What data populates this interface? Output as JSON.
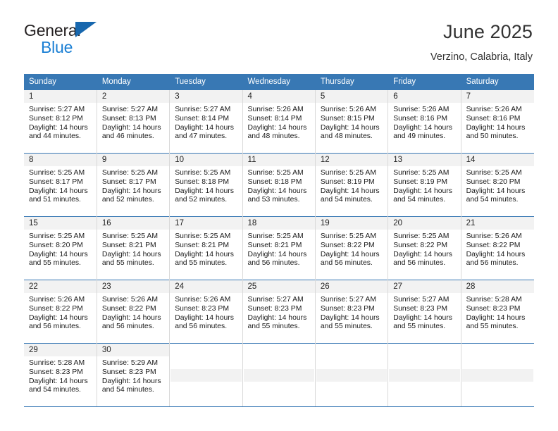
{
  "brand": {
    "name_part1": "General",
    "name_part2": "Blue",
    "triangle_color": "#1767ae",
    "blue_color": "#1a7fd4"
  },
  "header": {
    "title": "June 2025",
    "subtitle": "Verzino, Calabria, Italy"
  },
  "calendar": {
    "header_bg": "#3878b4",
    "daynum_bg": "#f2f2f2",
    "weekdays": [
      "Sunday",
      "Monday",
      "Tuesday",
      "Wednesday",
      "Thursday",
      "Friday",
      "Saturday"
    ],
    "weeks": [
      [
        {
          "day": "1",
          "sunrise": "Sunrise: 5:27 AM",
          "sunset": "Sunset: 8:12 PM",
          "daylight_line1": "Daylight: 14 hours",
          "daylight_line2": "and 44 minutes."
        },
        {
          "day": "2",
          "sunrise": "Sunrise: 5:27 AM",
          "sunset": "Sunset: 8:13 PM",
          "daylight_line1": "Daylight: 14 hours",
          "daylight_line2": "and 46 minutes."
        },
        {
          "day": "3",
          "sunrise": "Sunrise: 5:27 AM",
          "sunset": "Sunset: 8:14 PM",
          "daylight_line1": "Daylight: 14 hours",
          "daylight_line2": "and 47 minutes."
        },
        {
          "day": "4",
          "sunrise": "Sunrise: 5:26 AM",
          "sunset": "Sunset: 8:14 PM",
          "daylight_line1": "Daylight: 14 hours",
          "daylight_line2": "and 48 minutes."
        },
        {
          "day": "5",
          "sunrise": "Sunrise: 5:26 AM",
          "sunset": "Sunset: 8:15 PM",
          "daylight_line1": "Daylight: 14 hours",
          "daylight_line2": "and 48 minutes."
        },
        {
          "day": "6",
          "sunrise": "Sunrise: 5:26 AM",
          "sunset": "Sunset: 8:16 PM",
          "daylight_line1": "Daylight: 14 hours",
          "daylight_line2": "and 49 minutes."
        },
        {
          "day": "7",
          "sunrise": "Sunrise: 5:26 AM",
          "sunset": "Sunset: 8:16 PM",
          "daylight_line1": "Daylight: 14 hours",
          "daylight_line2": "and 50 minutes."
        }
      ],
      [
        {
          "day": "8",
          "sunrise": "Sunrise: 5:25 AM",
          "sunset": "Sunset: 8:17 PM",
          "daylight_line1": "Daylight: 14 hours",
          "daylight_line2": "and 51 minutes."
        },
        {
          "day": "9",
          "sunrise": "Sunrise: 5:25 AM",
          "sunset": "Sunset: 8:17 PM",
          "daylight_line1": "Daylight: 14 hours",
          "daylight_line2": "and 52 minutes."
        },
        {
          "day": "10",
          "sunrise": "Sunrise: 5:25 AM",
          "sunset": "Sunset: 8:18 PM",
          "daylight_line1": "Daylight: 14 hours",
          "daylight_line2": "and 52 minutes."
        },
        {
          "day": "11",
          "sunrise": "Sunrise: 5:25 AM",
          "sunset": "Sunset: 8:18 PM",
          "daylight_line1": "Daylight: 14 hours",
          "daylight_line2": "and 53 minutes."
        },
        {
          "day": "12",
          "sunrise": "Sunrise: 5:25 AM",
          "sunset": "Sunset: 8:19 PM",
          "daylight_line1": "Daylight: 14 hours",
          "daylight_line2": "and 54 minutes."
        },
        {
          "day": "13",
          "sunrise": "Sunrise: 5:25 AM",
          "sunset": "Sunset: 8:19 PM",
          "daylight_line1": "Daylight: 14 hours",
          "daylight_line2": "and 54 minutes."
        },
        {
          "day": "14",
          "sunrise": "Sunrise: 5:25 AM",
          "sunset": "Sunset: 8:20 PM",
          "daylight_line1": "Daylight: 14 hours",
          "daylight_line2": "and 54 minutes."
        }
      ],
      [
        {
          "day": "15",
          "sunrise": "Sunrise: 5:25 AM",
          "sunset": "Sunset: 8:20 PM",
          "daylight_line1": "Daylight: 14 hours",
          "daylight_line2": "and 55 minutes."
        },
        {
          "day": "16",
          "sunrise": "Sunrise: 5:25 AM",
          "sunset": "Sunset: 8:21 PM",
          "daylight_line1": "Daylight: 14 hours",
          "daylight_line2": "and 55 minutes."
        },
        {
          "day": "17",
          "sunrise": "Sunrise: 5:25 AM",
          "sunset": "Sunset: 8:21 PM",
          "daylight_line1": "Daylight: 14 hours",
          "daylight_line2": "and 55 minutes."
        },
        {
          "day": "18",
          "sunrise": "Sunrise: 5:25 AM",
          "sunset": "Sunset: 8:21 PM",
          "daylight_line1": "Daylight: 14 hours",
          "daylight_line2": "and 56 minutes."
        },
        {
          "day": "19",
          "sunrise": "Sunrise: 5:25 AM",
          "sunset": "Sunset: 8:22 PM",
          "daylight_line1": "Daylight: 14 hours",
          "daylight_line2": "and 56 minutes."
        },
        {
          "day": "20",
          "sunrise": "Sunrise: 5:25 AM",
          "sunset": "Sunset: 8:22 PM",
          "daylight_line1": "Daylight: 14 hours",
          "daylight_line2": "and 56 minutes."
        },
        {
          "day": "21",
          "sunrise": "Sunrise: 5:26 AM",
          "sunset": "Sunset: 8:22 PM",
          "daylight_line1": "Daylight: 14 hours",
          "daylight_line2": "and 56 minutes."
        }
      ],
      [
        {
          "day": "22",
          "sunrise": "Sunrise: 5:26 AM",
          "sunset": "Sunset: 8:22 PM",
          "daylight_line1": "Daylight: 14 hours",
          "daylight_line2": "and 56 minutes."
        },
        {
          "day": "23",
          "sunrise": "Sunrise: 5:26 AM",
          "sunset": "Sunset: 8:22 PM",
          "daylight_line1": "Daylight: 14 hours",
          "daylight_line2": "and 56 minutes."
        },
        {
          "day": "24",
          "sunrise": "Sunrise: 5:26 AM",
          "sunset": "Sunset: 8:23 PM",
          "daylight_line1": "Daylight: 14 hours",
          "daylight_line2": "and 56 minutes."
        },
        {
          "day": "25",
          "sunrise": "Sunrise: 5:27 AM",
          "sunset": "Sunset: 8:23 PM",
          "daylight_line1": "Daylight: 14 hours",
          "daylight_line2": "and 55 minutes."
        },
        {
          "day": "26",
          "sunrise": "Sunrise: 5:27 AM",
          "sunset": "Sunset: 8:23 PM",
          "daylight_line1": "Daylight: 14 hours",
          "daylight_line2": "and 55 minutes."
        },
        {
          "day": "27",
          "sunrise": "Sunrise: 5:27 AM",
          "sunset": "Sunset: 8:23 PM",
          "daylight_line1": "Daylight: 14 hours",
          "daylight_line2": "and 55 minutes."
        },
        {
          "day": "28",
          "sunrise": "Sunrise: 5:28 AM",
          "sunset": "Sunset: 8:23 PM",
          "daylight_line1": "Daylight: 14 hours",
          "daylight_line2": "and 55 minutes."
        }
      ],
      [
        {
          "day": "29",
          "sunrise": "Sunrise: 5:28 AM",
          "sunset": "Sunset: 8:23 PM",
          "daylight_line1": "Daylight: 14 hours",
          "daylight_line2": "and 54 minutes."
        },
        {
          "day": "30",
          "sunrise": "Sunrise: 5:29 AM",
          "sunset": "Sunset: 8:23 PM",
          "daylight_line1": "Daylight: 14 hours",
          "daylight_line2": "and 54 minutes."
        },
        null,
        null,
        null,
        null,
        null
      ]
    ]
  }
}
